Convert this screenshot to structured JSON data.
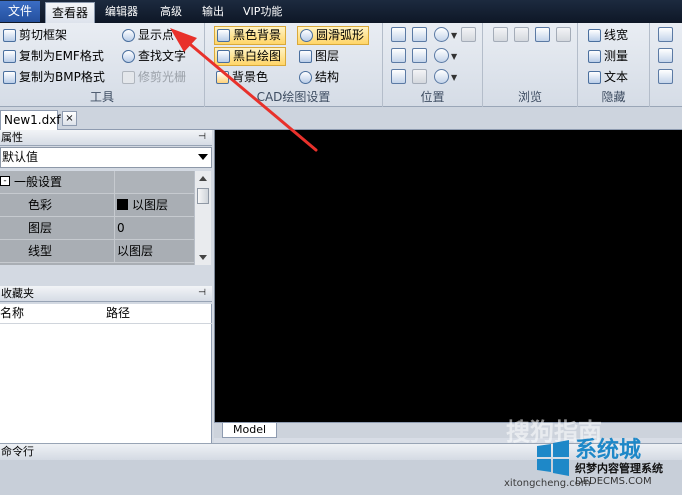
{
  "menu": {
    "file": "文件",
    "viewer": "查看器",
    "editor": "编辑器",
    "advanced": "高级",
    "output": "输出",
    "vip": "VIP功能"
  },
  "ribbon": {
    "tools": {
      "label": "工具",
      "clip_frame": "剪切框架",
      "copy_emf": "复制为EMF格式",
      "copy_bmp": "复制为BMP格式",
      "show_point": "显示点",
      "find_text": "查找文字",
      "trim_raster": "修剪光栅"
    },
    "cad_settings": {
      "label": "CAD绘图设置",
      "black_bg": "黑色背景",
      "bw_draw": "黑白绘图",
      "bg_color": "背景色",
      "smooth_arc": "圆滑弧形",
      "layers": "图层",
      "structure": "结构"
    },
    "position": {
      "label": "位置"
    },
    "browse": {
      "label": "浏览"
    },
    "hide": {
      "label": "隐藏",
      "line_width": "线宽",
      "measure": "测量",
      "text": "文本"
    }
  },
  "document_tab": {
    "name": "New1.dxf",
    "close": "×"
  },
  "properties": {
    "title": "属性",
    "combo_value": "默认值",
    "category": "一般设置",
    "expander": "-",
    "rows": [
      {
        "name": "色彩",
        "value": "以图层"
      },
      {
        "name": "图层",
        "value": "0"
      },
      {
        "name": "线型",
        "value": "以图层"
      }
    ]
  },
  "favorites": {
    "title": "收藏夹",
    "col_name": "名称",
    "col_path": "路径"
  },
  "canvas": {
    "model_tab": "Model"
  },
  "command_line": {
    "label": "命令行"
  },
  "watermarks": {
    "sogou": "搜狗指南",
    "xitongcheng": "系统城",
    "xtc_sub": "织梦内容管理系统",
    "xtc_url": "DEDECMS.COM",
    "xtc_url2": "xitongcheng.com"
  },
  "icons": {
    "pin": "⊣"
  }
}
